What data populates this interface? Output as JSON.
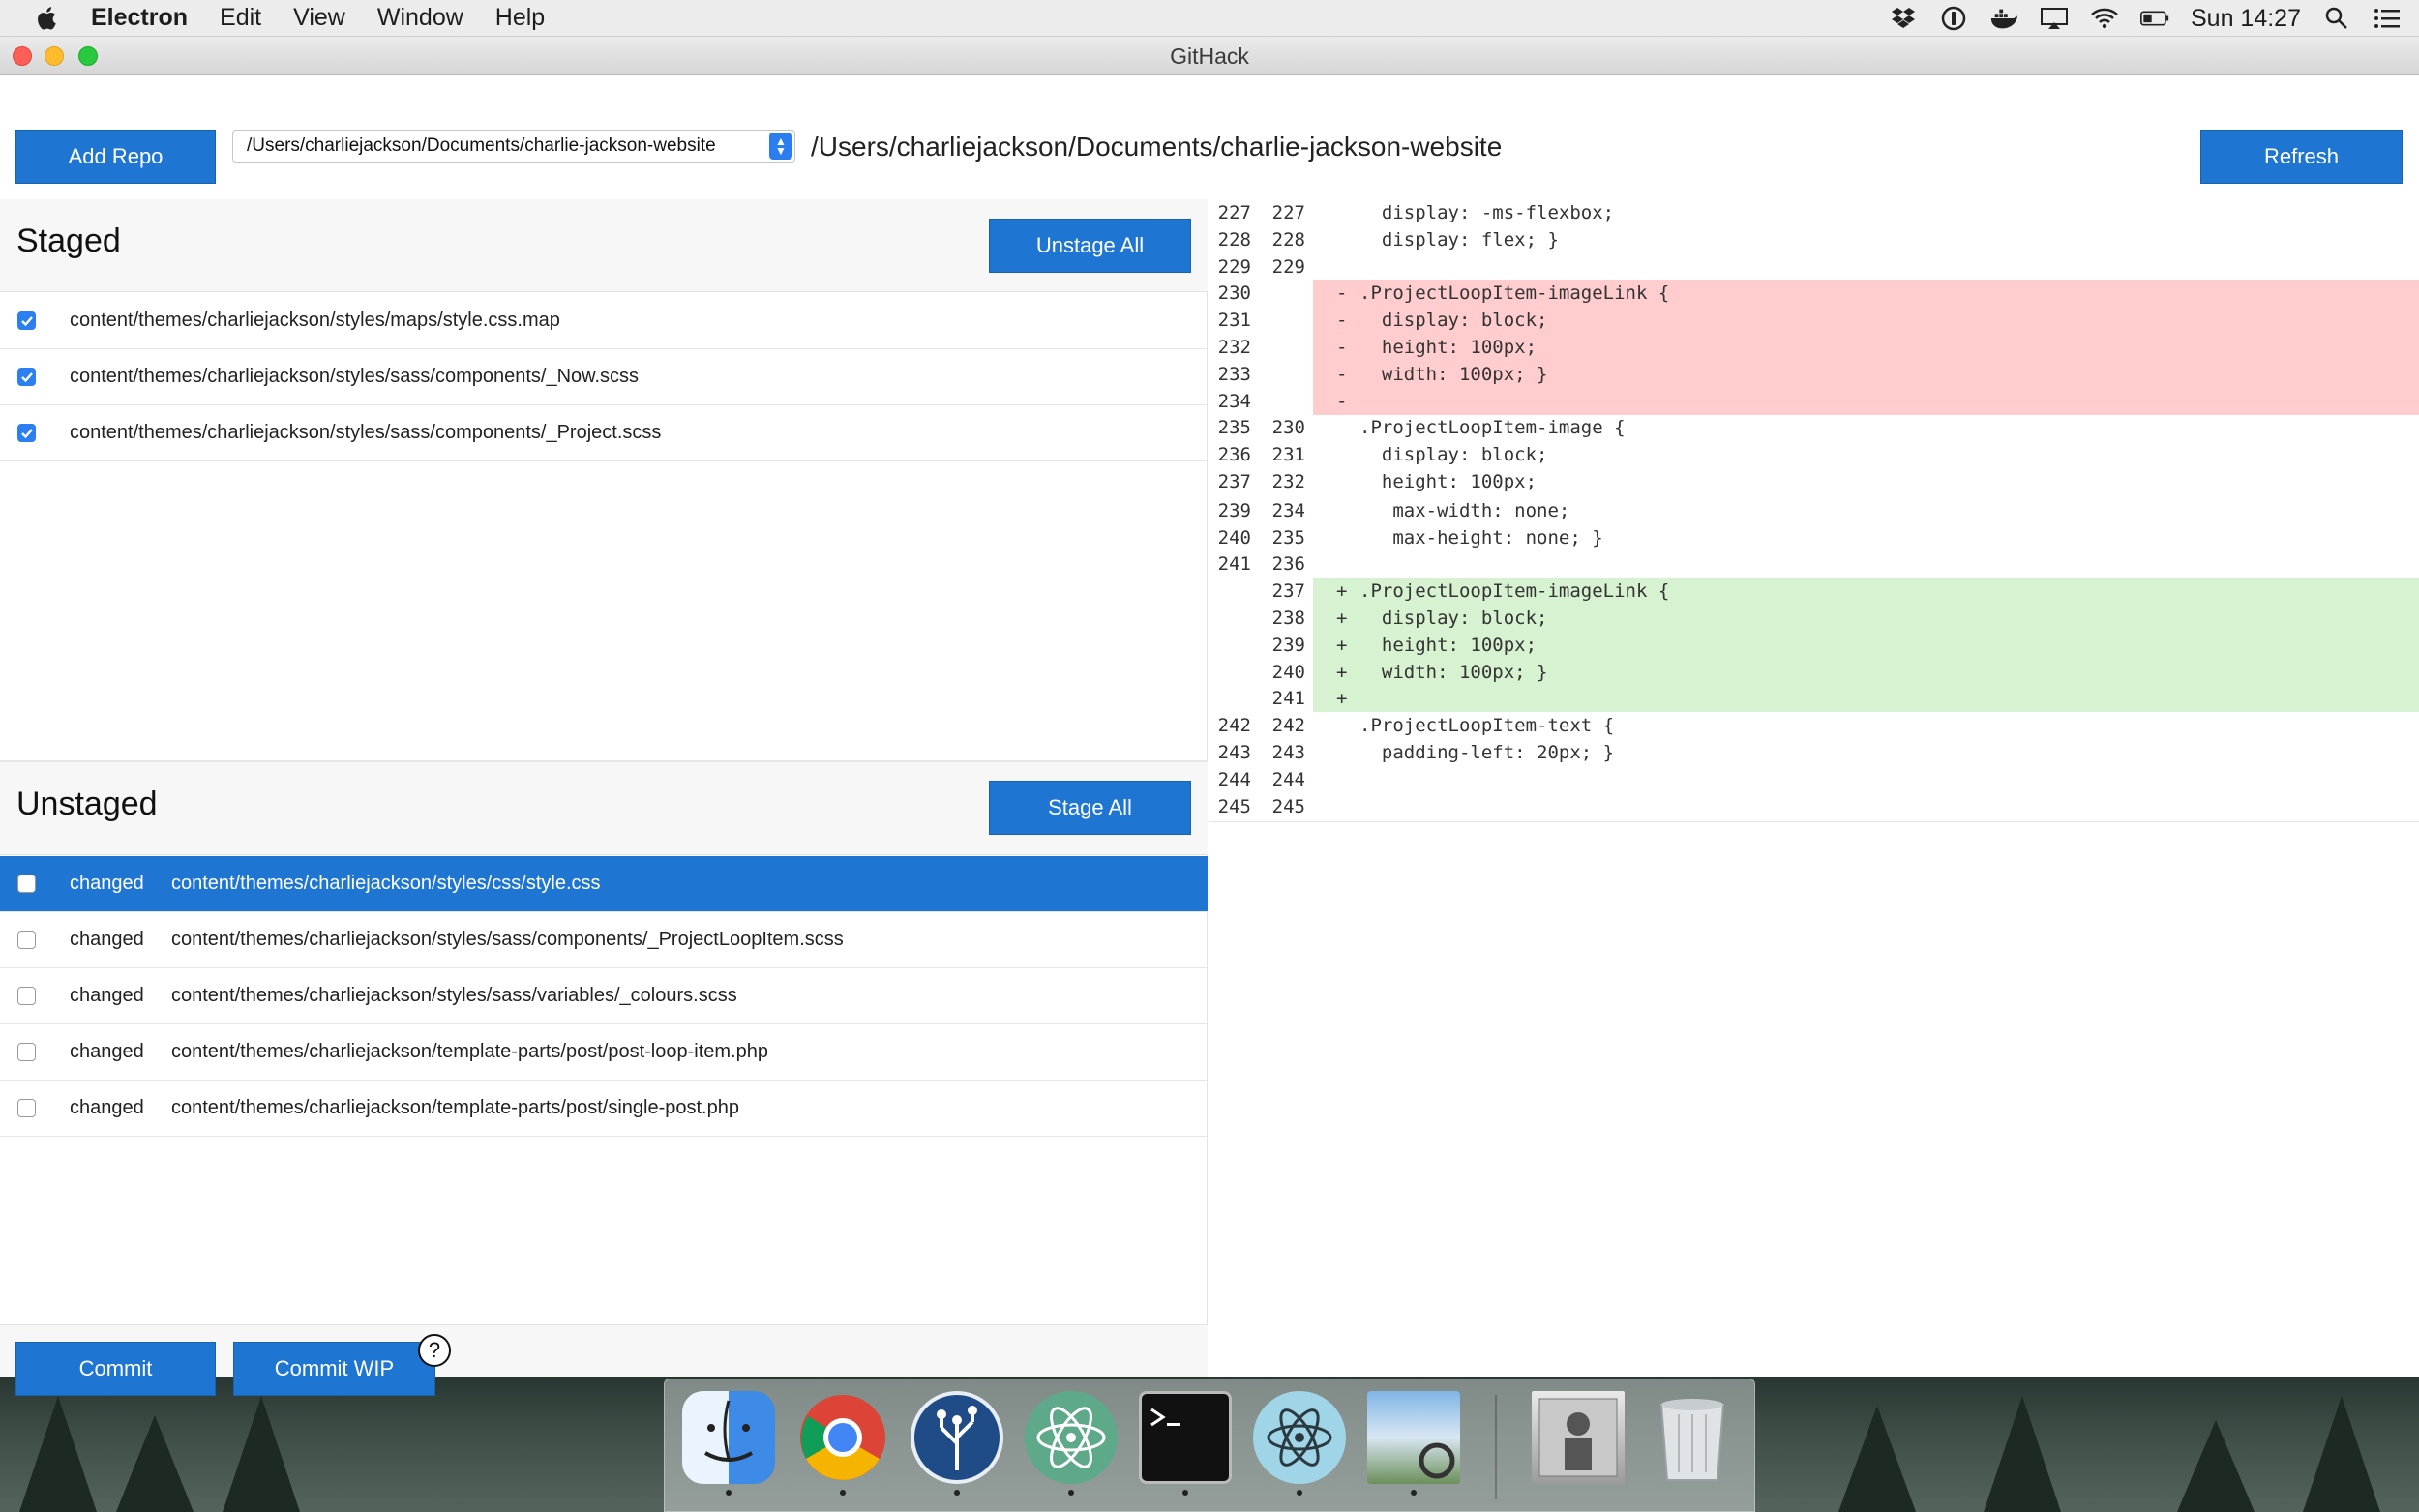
{
  "menubar": {
    "app_name": "Electron",
    "items": [
      "Edit",
      "View",
      "Window",
      "Help"
    ],
    "clock": "Sun 14:27"
  },
  "window": {
    "title": "GitHack"
  },
  "toolbar": {
    "add_repo_label": "Add Repo",
    "repo_select_value": "/Users/charliejackson/Documents/charlie-jackson-website",
    "repo_path": "/Users/charliejackson/Documents/charlie-jackson-website",
    "refresh_label": "Refresh"
  },
  "staged": {
    "title": "Staged",
    "unstage_all_label": "Unstage All",
    "files": [
      {
        "path": "content/themes/charliejackson/styles/maps/style.css.map",
        "checked": true
      },
      {
        "path": "content/themes/charliejackson/styles/sass/components/_Now.scss",
        "checked": true
      },
      {
        "path": "content/themes/charliejackson/styles/sass/components/_Project.scss",
        "checked": true
      }
    ]
  },
  "unstaged": {
    "title": "Unstaged",
    "stage_all_label": "Stage All",
    "files": [
      {
        "status": "changed",
        "path": "content/themes/charliejackson/styles/css/style.css",
        "checked": false,
        "selected": true
      },
      {
        "status": "changed",
        "path": "content/themes/charliejackson/styles/sass/components/_ProjectLoopItem.scss",
        "checked": false,
        "selected": false
      },
      {
        "status": "changed",
        "path": "content/themes/charliejackson/styles/sass/variables/_colours.scss",
        "checked": false,
        "selected": false
      },
      {
        "status": "changed",
        "path": "content/themes/charliejackson/template-parts/post/post-loop-item.php",
        "checked": false,
        "selected": false
      },
      {
        "status": "changed",
        "path": "content/themes/charliejackson/template-parts/post/single-post.php",
        "checked": false,
        "selected": false
      }
    ]
  },
  "footer": {
    "commit_label": "Commit",
    "commit_wip_label": "Commit WIP",
    "help_label": "?"
  },
  "diff": {
    "lines": [
      {
        "old": "227",
        "new": "227",
        "type": "ctx",
        "marker": "",
        "code": "  display: -ms-flexbox;"
      },
      {
        "old": "228",
        "new": "228",
        "type": "ctx",
        "marker": "",
        "code": "  display: flex; }"
      },
      {
        "old": "229",
        "new": "229",
        "type": "ctx",
        "marker": "",
        "code": ""
      },
      {
        "old": "230",
        "new": "",
        "type": "del",
        "marker": "-",
        "code": ".ProjectLoopItem-imageLink {"
      },
      {
        "old": "231",
        "new": "",
        "type": "del",
        "marker": "-",
        "code": "  display: block;"
      },
      {
        "old": "232",
        "new": "",
        "type": "del",
        "marker": "-",
        "code": "  height: 100px;"
      },
      {
        "old": "233",
        "new": "",
        "type": "del",
        "marker": "-",
        "code": "  width: 100px; }"
      },
      {
        "old": "234",
        "new": "",
        "type": "del",
        "marker": "-",
        "code": ""
      },
      {
        "old": "235",
        "new": "230",
        "type": "ctx",
        "marker": "",
        "code": ".ProjectLoopItem-image {"
      },
      {
        "old": "236",
        "new": "231",
        "type": "ctx",
        "marker": "",
        "code": "  display: block;"
      },
      {
        "old": "237",
        "new": "232",
        "type": "ctx",
        "marker": "",
        "code": "  height: 100px;"
      },
      {
        "old": "239",
        "new": "234",
        "type": "ctx",
        "marker": "",
        "code": "   max-width: none;"
      },
      {
        "old": "240",
        "new": "235",
        "type": "ctx",
        "marker": "",
        "code": "   max-height: none; }"
      },
      {
        "old": "241",
        "new": "236",
        "type": "ctx",
        "marker": "",
        "code": ""
      },
      {
        "old": "",
        "new": "237",
        "type": "add",
        "marker": "+",
        "code": ".ProjectLoopItem-imageLink {"
      },
      {
        "old": "",
        "new": "238",
        "type": "add",
        "marker": "+",
        "code": "  display: block;"
      },
      {
        "old": "",
        "new": "239",
        "type": "add",
        "marker": "+",
        "code": "  height: 100px;"
      },
      {
        "old": "",
        "new": "240",
        "type": "add",
        "marker": "+",
        "code": "  width: 100px; }"
      },
      {
        "old": "",
        "new": "241",
        "type": "add",
        "marker": "+",
        "code": ""
      },
      {
        "old": "242",
        "new": "242",
        "type": "ctx",
        "marker": "",
        "code": ".ProjectLoopItem-text {"
      },
      {
        "old": "243",
        "new": "243",
        "type": "ctx",
        "marker": "",
        "code": "  padding-left: 20px; }"
      },
      {
        "old": "244",
        "new": "244",
        "type": "ctx",
        "marker": "",
        "code": ""
      },
      {
        "old": "245",
        "new": "245",
        "type": "ctx",
        "marker": "",
        "code": ""
      }
    ]
  },
  "dock": {
    "apps": [
      "finder-icon",
      "chrome-icon",
      "sourcetree-icon",
      "atom-icon",
      "terminal-icon",
      "electron-icon",
      "preview-icon",
      "downloads-stack-icon",
      "trash-icon"
    ]
  },
  "colors": {
    "accent": "#1e76d2",
    "deletion_bg": "#ffcdcd",
    "addition_bg": "#d6f2d0"
  }
}
